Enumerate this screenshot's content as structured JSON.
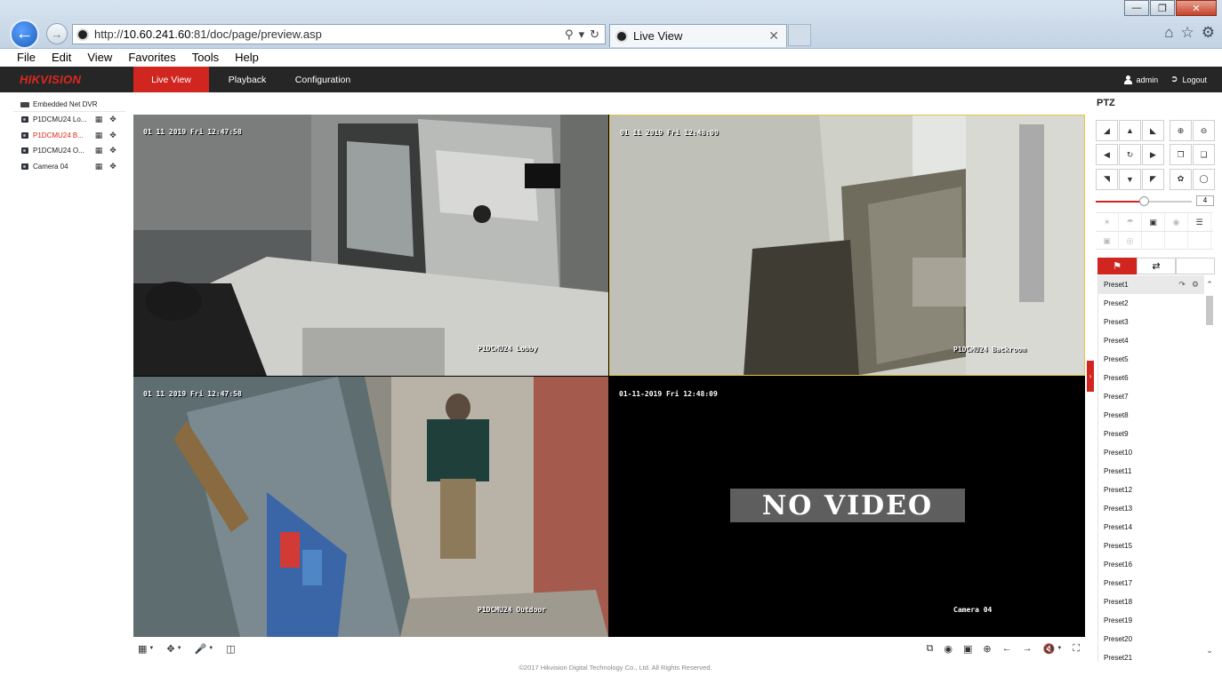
{
  "browser": {
    "url_prefix": "http://",
    "url_host": "10.60.241.60",
    "url_rest": ":81/doc/page/preview.asp",
    "tab_title": "Live View",
    "menu": [
      "File",
      "Edit",
      "View",
      "Favorites",
      "Tools",
      "Help"
    ]
  },
  "app": {
    "logo": "HIKVISION",
    "nav": [
      "Live View",
      "Playback",
      "Configuration"
    ],
    "active_nav": "Live View",
    "user": "admin",
    "logout": "Logout",
    "accent_color": "#d0261f"
  },
  "sidebar": {
    "root": "Embedded Net DVR",
    "cameras": [
      {
        "label": "P1DCMU24 Lo...",
        "active": false
      },
      {
        "label": "P1DCMU24 B...",
        "active": true
      },
      {
        "label": "P1DCMU24 O...",
        "active": false
      },
      {
        "label": "Camera 04",
        "active": false
      }
    ]
  },
  "videos": [
    {
      "time": "01 11 2019 Fri 12:47:58",
      "name": "P1DCMU24 Lobby"
    },
    {
      "time": "01 11 2019 Fri 12:48:00",
      "name": "P1DCMU24 Backroom"
    },
    {
      "time": "01 11 2019 Fri 12:47:58",
      "name": "P1DCMU24 Outdoor"
    },
    {
      "time": "01-11-2019 Fri 12:48:09",
      "name": "Camera 04",
      "overlay": "NO VIDEO"
    }
  ],
  "footer": "©2017 Hikvision Digital Technology Co., Ltd. All Rights Reserved.",
  "ptz": {
    "title": "PTZ",
    "speed": "4",
    "speed_fraction": 0.5,
    "presets": [
      "Preset1",
      "Preset2",
      "Preset3",
      "Preset4",
      "Preset5",
      "Preset6",
      "Preset7",
      "Preset8",
      "Preset9",
      "Preset10",
      "Preset11",
      "Preset12",
      "Preset13",
      "Preset14",
      "Preset15",
      "Preset16",
      "Preset17",
      "Preset18",
      "Preset19",
      "Preset20",
      "Preset21"
    ]
  }
}
